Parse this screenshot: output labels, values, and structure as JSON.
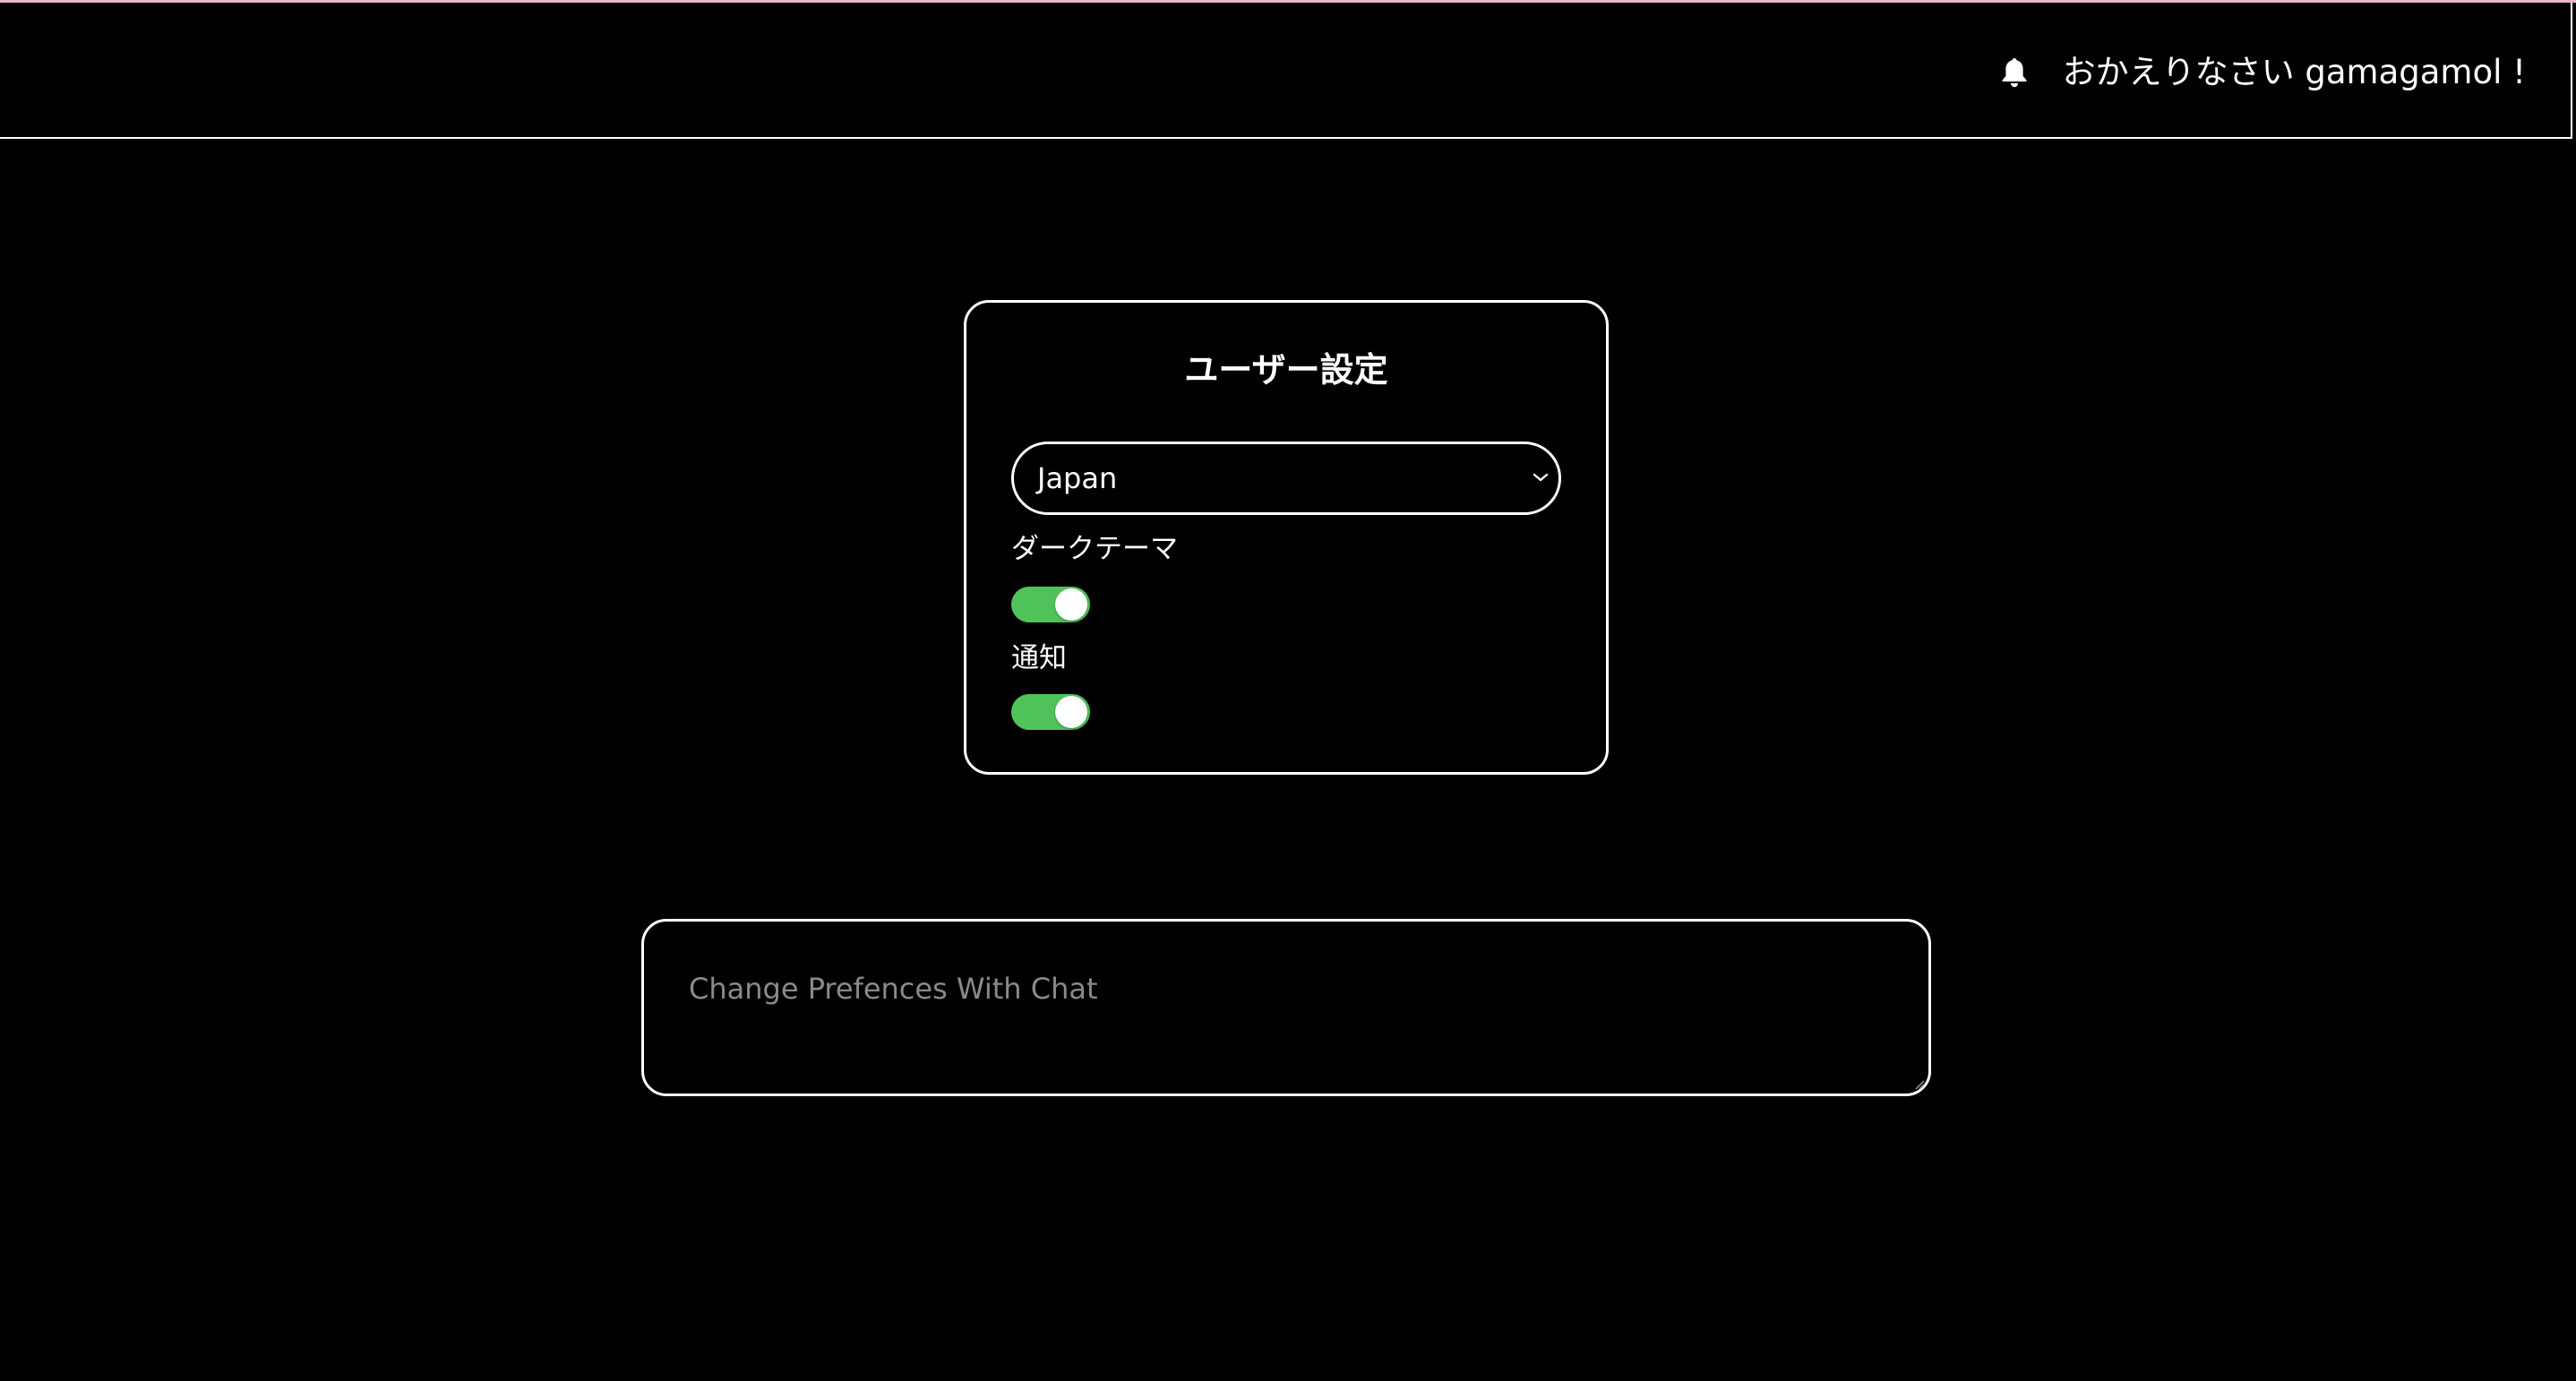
{
  "header": {
    "welcome_text": "おかえりなさい gamagamol !",
    "bell_icon": "bell-icon",
    "accent_color": "#e8b4c8"
  },
  "settings": {
    "title": "ユーザー設定",
    "country": {
      "selected": "Japan"
    },
    "dark_theme": {
      "label": "ダークテーマ",
      "enabled": true
    },
    "notifications": {
      "label": "通知",
      "enabled": true
    },
    "toggle_on_color": "#4fc35a"
  },
  "chat": {
    "placeholder": "Change Prefences With Chat"
  }
}
